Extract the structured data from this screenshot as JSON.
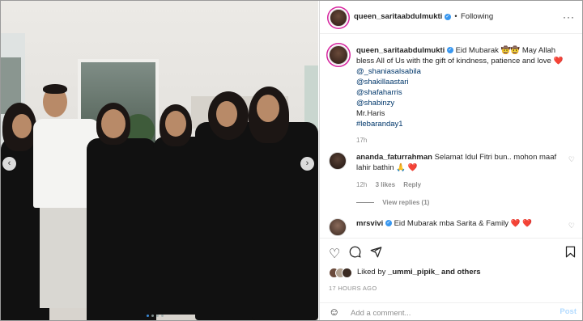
{
  "header": {
    "username": "queen_saritaabdulmukti",
    "separator": "•",
    "follow_status": "Following",
    "more_icon": "more-horizontal-icon"
  },
  "caption": {
    "username": "queen_saritaabdulmukti",
    "text": "Eid Mubarak 🤠🤠 May Allah bless All of Us with the gift of kindness, patience and love ❤️",
    "mentions": [
      "@_shaniasalsabila",
      "@shakillaastari",
      "@shafaharris",
      "@shabinzy"
    ],
    "extra_line": "Mr.Haris",
    "hashtag": "#lebaranday1",
    "time": "17h"
  },
  "comments": [
    {
      "username": "ananda_faturrahman",
      "text": "Selamat Idul Fitri bun.. mohon maaf lahir bathin 🙏 ❤️",
      "time": "12h",
      "likes": "3 likes",
      "reply": "Reply",
      "view_replies": "View replies (1)"
    },
    {
      "username": "mrsvivi",
      "text": "Eid Mubarak mba Sarita & Family ❤️ ❤️"
    }
  ],
  "actions": {
    "like_icon": "heart-icon",
    "comment_icon": "comment-icon",
    "share_icon": "share-icon",
    "save_icon": "bookmark-icon"
  },
  "likes": {
    "prefix": "Liked by",
    "user": "_ummi_pipik_",
    "suffix": "and others"
  },
  "posted_ago": "17 HOURS AGO",
  "add_comment": {
    "placeholder": "Add a comment...",
    "post_label": "Post",
    "emoji_icon": "smile-icon"
  },
  "carousel": {
    "prev_icon": "chevron-left-icon",
    "next_icon": "chevron-right-icon",
    "dots": 4,
    "active_dot": 1
  },
  "colors": {
    "link": "#00376b",
    "verified": "#3897f0",
    "like_heart": "#e0243a",
    "post_disabled": "#b3dbff"
  }
}
